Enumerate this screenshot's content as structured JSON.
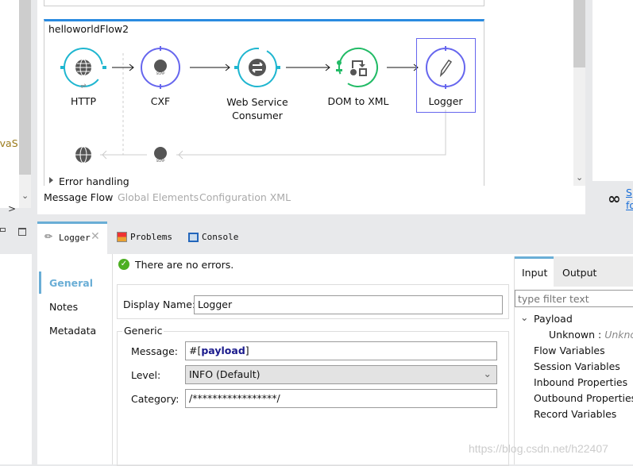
{
  "left_strip": {
    "partial_text": "avaS"
  },
  "flow": {
    "name": "helloworldFlow2",
    "nodes": [
      {
        "label": "HTTP",
        "icon": "globe-icon",
        "color": "#1fb6d0"
      },
      {
        "label": "CXF",
        "icon": "soap-globe-icon",
        "color": "#6666ee"
      },
      {
        "label": "Web Service",
        "label2": "Consumer",
        "icon": "exchange-icon",
        "color": "#1fb6d0"
      },
      {
        "label": "DOM to XML",
        "icon": "transform-icon",
        "color": "#22bb66"
      },
      {
        "label": "Logger",
        "icon": "pencil-icon",
        "color": "#6666ee",
        "selected": true
      }
    ],
    "error_handling": "Error handling"
  },
  "editor_tabs": [
    {
      "label": "Message Flow",
      "active": true
    },
    {
      "label": "Global Elements"
    },
    {
      "label": "Configuration XML"
    }
  ],
  "side_link": {
    "line1": "S",
    "line2": "fo"
  },
  "view_tabs": [
    {
      "label": "Logger",
      "icon": "pencil-icon",
      "active": true
    },
    {
      "label": "Problems",
      "icon": "problems-icon"
    },
    {
      "label": "Console",
      "icon": "console-icon"
    }
  ],
  "properties": {
    "nav": [
      "General",
      "Notes",
      "Metadata"
    ],
    "status": "There are no errors.",
    "display_name_label": "Display Name:",
    "display_name_value": "Logger",
    "group_title": "Generic",
    "message_label": "Message:",
    "message_prefix": "#[",
    "message_keyword": "payload",
    "message_suffix": "]",
    "level_label": "Level:",
    "level_value": "INFO (Default)",
    "category_label": "Category:",
    "category_value": "/*****************/"
  },
  "metadata": {
    "tabs": [
      "Input",
      "Output"
    ],
    "filter_placeholder": "type filter text",
    "payload": "Payload",
    "payload_child_key": "Unknown :",
    "payload_child_value": "Unknown",
    "items": [
      "Flow Variables",
      "Session Variables",
      "Inbound Properties",
      "Outbound Properties",
      "Record Variables"
    ]
  },
  "watermark": "https://blog.csdn.net/h22407",
  "colors": {
    "accent": "#2a8be0",
    "nav_active": "#6aaed6",
    "selection": "#6666ee"
  }
}
